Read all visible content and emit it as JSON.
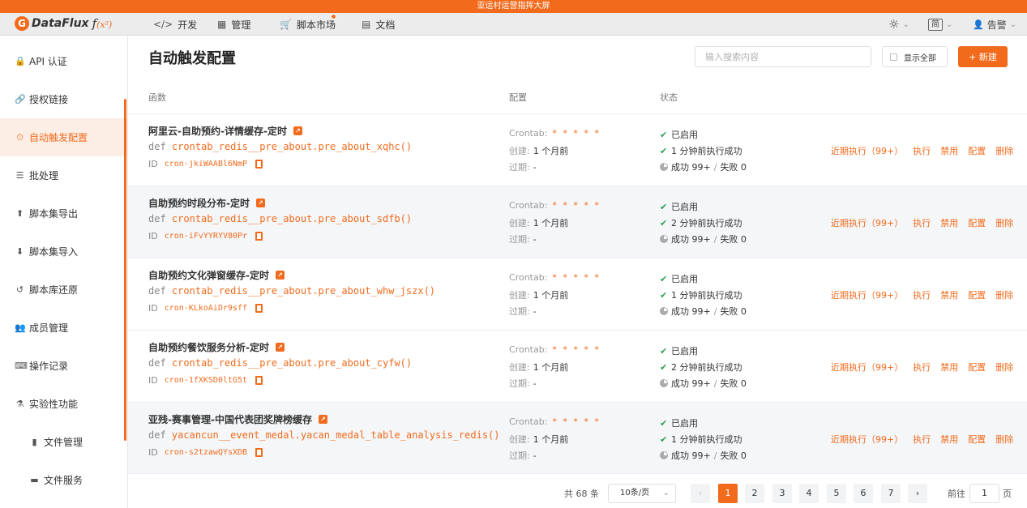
{
  "banner": {
    "title": "亚运村运营指挥大屏"
  },
  "navbar": {
    "logo_letter": "G",
    "logo_text": "DataFlux",
    "logo_fx": "f",
    "logo_fx_sup": "(x²)",
    "items": [
      {
        "icon": "</>",
        "label": "开发"
      },
      {
        "icon": "▦",
        "label": "管理"
      },
      {
        "icon": "🛒",
        "label": "脚本市场"
      },
      {
        "icon": "▤",
        "label": "文档"
      }
    ],
    "theme_icon": "☼",
    "lang": "简",
    "user": "告警",
    "chevron": "⌄"
  },
  "sidebar": {
    "items": [
      {
        "icon": "🔒",
        "label": "API 认证"
      },
      {
        "icon": "🔗",
        "label": "授权链接"
      },
      {
        "icon": "⏱",
        "label": "自动触发配置"
      },
      {
        "icon": "☰",
        "label": "批处理"
      },
      {
        "icon": "⬆",
        "label": "脚本集导出"
      },
      {
        "icon": "⬇",
        "label": "脚本集导入"
      },
      {
        "icon": "↺",
        "label": "脚本库还原"
      },
      {
        "icon": "👥",
        "label": "成员管理"
      },
      {
        "icon": "⌨",
        "label": "操作记录"
      },
      {
        "icon": "⚗",
        "label": "实验性功能"
      },
      {
        "icon": "▮",
        "label": "文件管理"
      },
      {
        "icon": "▬",
        "label": "文件服务"
      }
    ]
  },
  "main": {
    "title": "自动触发配置",
    "search_placeholder": "输入搜索内容",
    "show_all_label": "显示全部",
    "new_label": "+ 新建",
    "columns": {
      "func": "函数",
      "config": "配置",
      "status": "状态"
    }
  },
  "labels": {
    "def": "def",
    "id": "ID",
    "crontab": "Crontab:",
    "created": "创建:",
    "expire": "过期:",
    "enabled": "已启用",
    "check": "✔",
    "sep": "/"
  },
  "rows": [
    {
      "title": "阿里云-自助预约-详情缓存-定时",
      "func": "crontab_redis__pre_about.pre_about_xqhc()",
      "id": "cron-jkiWAABl6NmP",
      "crontab": "* * * * *",
      "created": "1 个月前",
      "expire": "-",
      "last_run": "1 分钟前执行成功",
      "success": "成功 99+",
      "fail": "失败 0"
    },
    {
      "title": "自助预约时段分布-定时",
      "func": "crontab_redis__pre_about.pre_about_sdfb()",
      "id": "cron-iFvYYRYV80Pr",
      "crontab": "* * * * *",
      "created": "1 个月前",
      "expire": "-",
      "last_run": "2 分钟前执行成功",
      "success": "成功 99+",
      "fail": "失败 0"
    },
    {
      "title": "自助预约文化弹窗缓存-定时",
      "func": "crontab_redis__pre_about.pre_about_whw_jszx()",
      "id": "cron-KLkoAiDr9sff",
      "crontab": "* * * * *",
      "created": "1 个月前",
      "expire": "-",
      "last_run": "1 分钟前执行成功",
      "success": "成功 99+",
      "fail": "失败 0"
    },
    {
      "title": "自助预约餐饮服务分析-定时",
      "func": "crontab_redis__pre_about.pre_about_cyfw()",
      "id": "cron-1fXKSD0ltG5t",
      "crontab": "* * * * *",
      "created": "1 个月前",
      "expire": "-",
      "last_run": "2 分钟前执行成功",
      "success": "成功 99+",
      "fail": "失败 0"
    },
    {
      "title": "亚残-赛事管理-中国代表团奖牌榜缓存",
      "func": "yacancun__event_medal.yacan_medal_table_analysis_redis()",
      "id": "cron-s2tzawQYsXDB",
      "crontab": "* * * * *",
      "created": "1 个月前",
      "expire": "-",
      "last_run": "1 分钟前执行成功",
      "success": "成功 99+",
      "fail": "失败 0"
    }
  ],
  "actions": {
    "recent": "近期执行（99+）",
    "run": "执行",
    "disable": "禁用",
    "config": "配置",
    "delete": "删除"
  },
  "pagination": {
    "total": "共 68 条",
    "page_size": "10条/页",
    "prev": "‹",
    "next": "›",
    "pages": [
      "1",
      "2",
      "3",
      "4",
      "5",
      "6",
      "7"
    ],
    "goto_label": "前往",
    "goto_value": "1",
    "page_suffix": "页"
  },
  "colors": {
    "accent": "#f26b1d",
    "success": "#2f9d52"
  }
}
